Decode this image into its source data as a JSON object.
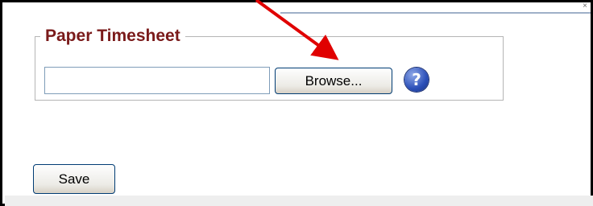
{
  "form": {
    "section_title": "Paper Timesheet",
    "file_value": "",
    "browse_label": "Browse...",
    "help_glyph": "?",
    "save_label": "Save"
  },
  "top_strip": {
    "close_glyph": "×"
  },
  "annotation": {
    "arrow_color": "#e00000"
  }
}
